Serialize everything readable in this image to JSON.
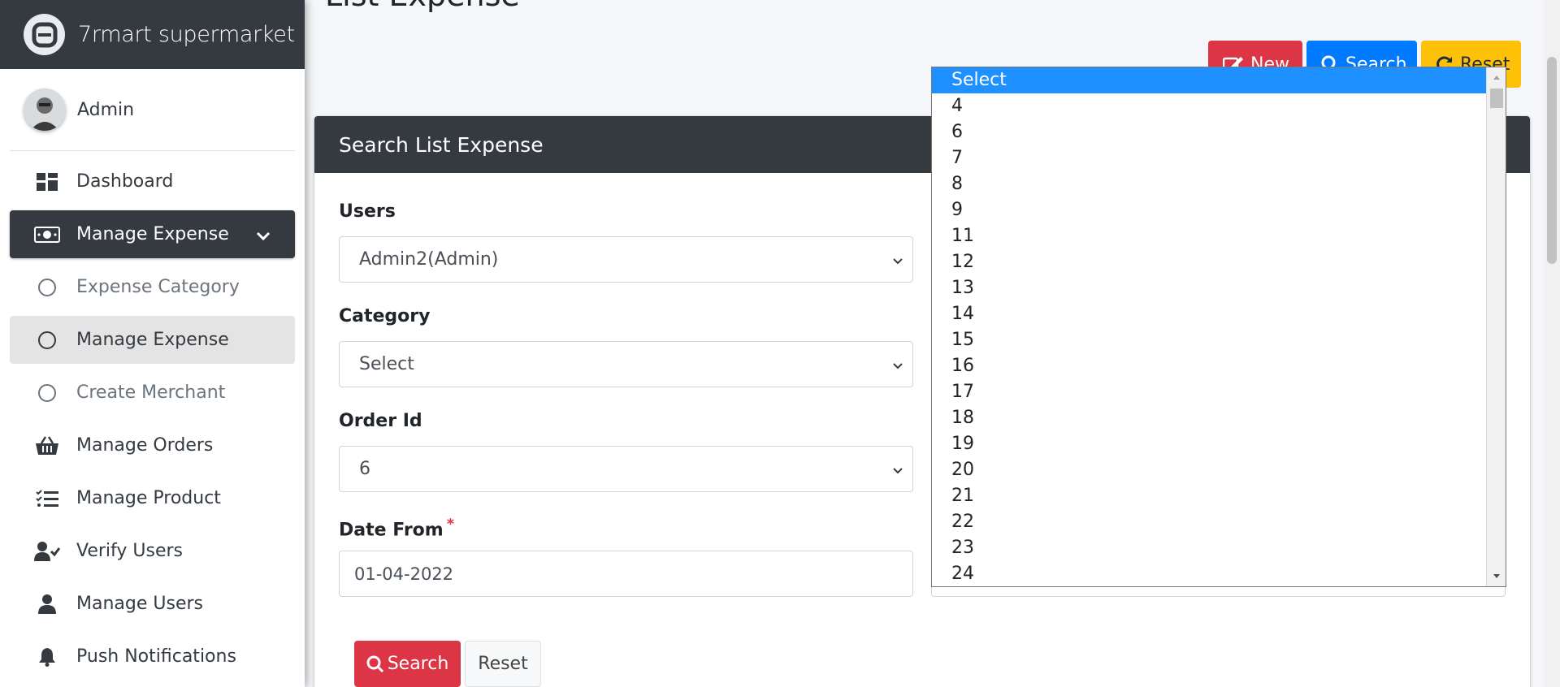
{
  "brand": {
    "name": "7rmart supermarket"
  },
  "user": {
    "name": "Admin"
  },
  "sidebar": {
    "items": [
      {
        "label": "Dashboard",
        "icon": "dashboard-icon"
      },
      {
        "label": "Manage Expense",
        "icon": "money-bill-icon"
      },
      {
        "label": "Expense Category",
        "icon": "circle-icon"
      },
      {
        "label": "Manage Expense",
        "icon": "circle-icon"
      },
      {
        "label": "Create Merchant",
        "icon": "circle-icon"
      },
      {
        "label": "Manage Orders",
        "icon": "basket-icon"
      },
      {
        "label": "Manage Product",
        "icon": "list-check-icon"
      },
      {
        "label": "Verify Users",
        "icon": "user-check-icon"
      },
      {
        "label": "Manage Users",
        "icon": "user-icon"
      },
      {
        "label": "Push Notifications",
        "icon": "bell-icon"
      }
    ]
  },
  "page": {
    "title": "List Expense"
  },
  "toolbar": {
    "new_label": "New",
    "search_label": "Search",
    "reset_label": "Reset"
  },
  "card": {
    "title": "Search List Expense"
  },
  "form": {
    "users_label": "Users",
    "users_value": "Admin2(Admin)",
    "category_label": "Category",
    "category_value": "Select",
    "order_label": "Order Id",
    "order_value": "6",
    "date_from_label": "Date From",
    "date_from_required": "*",
    "date_from_value": "01-04-2022",
    "search_button": "Search",
    "reset_button": "Reset"
  },
  "dropdown": {
    "options": [
      "Select",
      "4",
      "6",
      "7",
      "8",
      "9",
      "11",
      "12",
      "13",
      "14",
      "15",
      "16",
      "17",
      "18",
      "19",
      "20",
      "21",
      "22",
      "23",
      "24"
    ],
    "highlighted": "Select"
  },
  "colors": {
    "dark": "#343a40",
    "danger": "#dc3545",
    "primary": "#007bff",
    "warning": "#ffc107",
    "highlight": "#1e90ff"
  }
}
